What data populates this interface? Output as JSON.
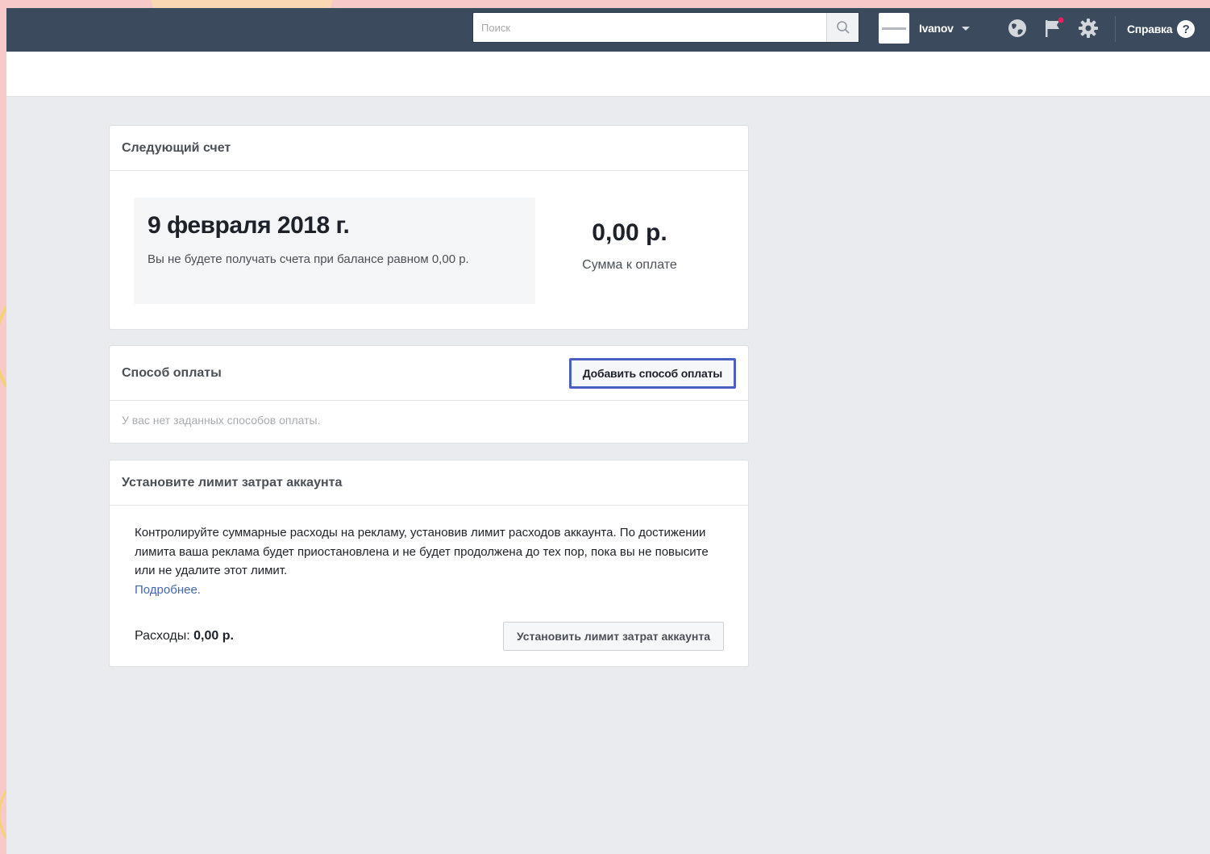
{
  "topbar": {
    "search_placeholder": "Поиск",
    "search_icon": "search-icon",
    "user_name": "Ivanov",
    "icons": [
      "globe-icon",
      "flag-icon",
      "gear-icon"
    ],
    "help_label": "Справка",
    "help_icon_glyph": "?"
  },
  "invoice": {
    "title": "Следующий счет",
    "date": "9 февраля 2018 г.",
    "note": "Вы не будете получать счета при балансе равном 0,00 р.",
    "amount": "0,00 р.",
    "amount_label": "Сумма к оплате"
  },
  "payment": {
    "title": "Способ оплаты",
    "add_button": "Добавить способ оплаты",
    "empty_text": "У вас нет заданных способов оплаты."
  },
  "limit": {
    "title": "Установите лимит затрат аккаунта",
    "description": "Контролируйте суммарные расходы на рекламу, установив лимит расходов аккаунта. По достижении лимита ваша реклама будет приостановлена и не будет продолжена до тех пор, пока вы не повысите или не удалите этот лимит.",
    "learn_more": "Подробнее.",
    "spend_label": "Расходы:",
    "spend_value": "0,00 р.",
    "set_button": "Установить лимит затрат аккаунта"
  },
  "colors": {
    "topbar": "#3b4a5c",
    "page_bg": "#e9ebee",
    "accent_focus": "#4a5fc1",
    "link": "#4267b2",
    "notification_dot": "#e0245e"
  }
}
